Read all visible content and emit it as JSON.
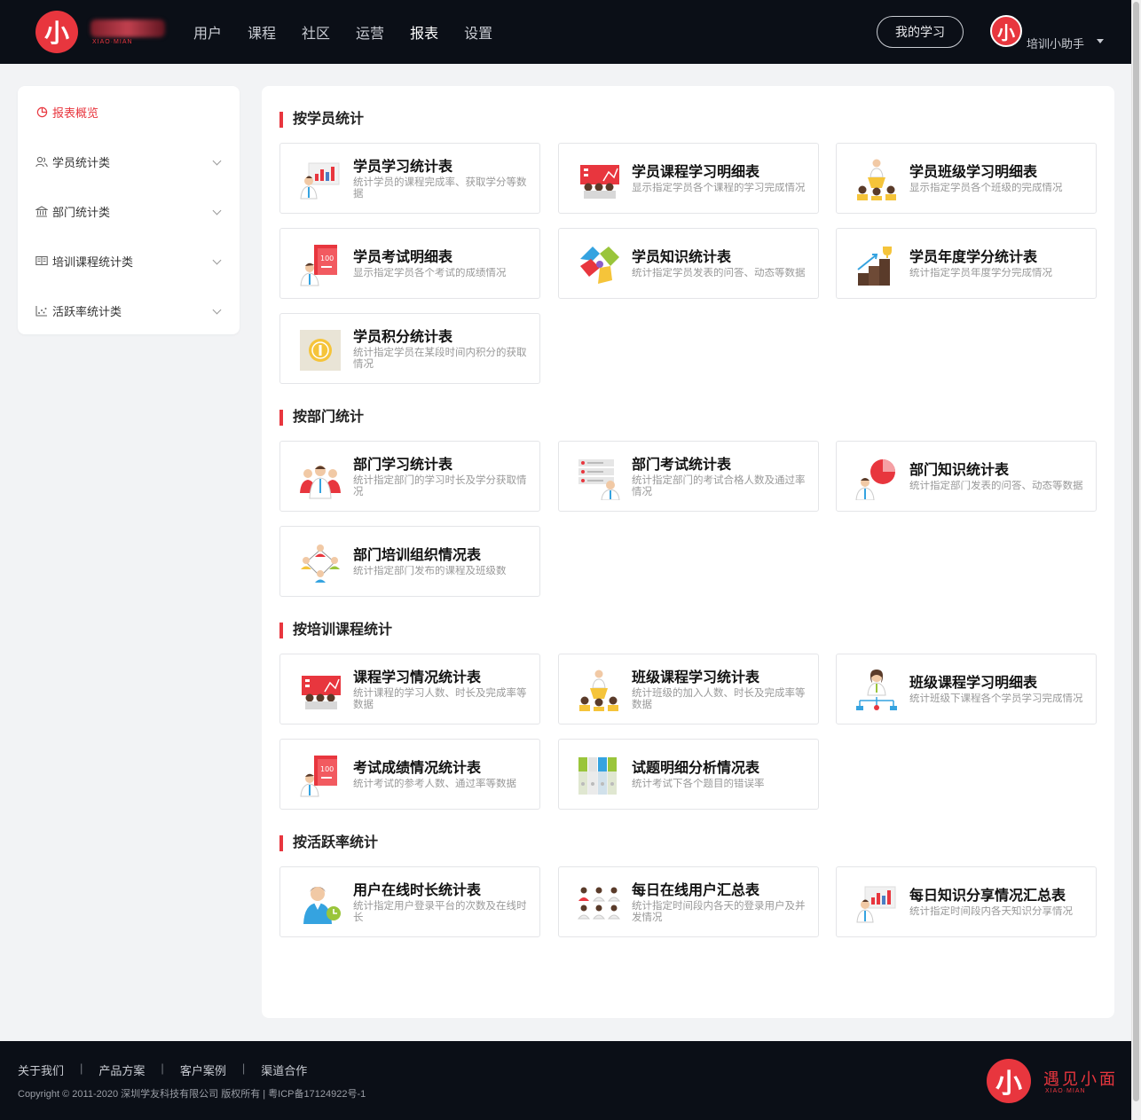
{
  "header": {
    "logo_char": "小",
    "logo_sub": "XIAO·MIAN",
    "nav": [
      "用户",
      "课程",
      "社区",
      "运营",
      "报表",
      "设置"
    ],
    "nav_active_index": 4,
    "my_study": "我的学习",
    "avatar_char": "小",
    "user_name": "培训小助手"
  },
  "sidebar": {
    "items": [
      {
        "label": "报表概览",
        "icon": "pie-chart-icon",
        "active": true
      },
      {
        "label": "学员统计类",
        "icon": "users-icon"
      },
      {
        "label": "部门统计类",
        "icon": "bank-icon"
      },
      {
        "label": "培训课程统计类",
        "icon": "book-icon"
      },
      {
        "label": "活跃率统计类",
        "icon": "scatter-chart-icon"
      }
    ]
  },
  "sections": [
    {
      "title": "按学员统计",
      "cards": [
        {
          "title": "学员学习统计表",
          "desc": "统计学员的课程完成率、获取学分等数据",
          "icon": "presenter-chart-icon"
        },
        {
          "title": "学员课程学习明细表",
          "desc": "显示指定学员各个课程的学习完成情况",
          "icon": "classroom-icon"
        },
        {
          "title": "学员班级学习明细表",
          "desc": "显示指定学员各个班级的完成情况",
          "icon": "podium-speaker-icon"
        },
        {
          "title": "学员考试明细表",
          "desc": "显示指定学员各个考试的成绩情况",
          "icon": "exam-score-icon"
        },
        {
          "title": "学员知识统计表",
          "desc": "统计指定学员发表的问答、动态等数据",
          "icon": "puzzle-icon"
        },
        {
          "title": "学员年度学分统计表",
          "desc": "统计指定学员年度学分完成情况",
          "icon": "trophy-stairs-icon"
        },
        {
          "title": "学员积分统计表",
          "desc": "统计指定学员在某段时间内积分的获取情况",
          "icon": "coin-icon"
        }
      ]
    },
    {
      "title": "按部门统计",
      "cards": [
        {
          "title": "部门学习统计表",
          "desc": "统计指定部门的学习时长及学分获取情况",
          "icon": "team-icon"
        },
        {
          "title": "部门考试统计表",
          "desc": "统计指定部门的考试合格人数及通过率情况",
          "icon": "server-person-icon"
        },
        {
          "title": "部门知识统计表",
          "desc": "统计指定部门发表的问答、动态等数据",
          "icon": "pie-person-icon"
        },
        {
          "title": "部门培训组织情况表",
          "desc": "统计指定部门发布的课程及班级数",
          "icon": "network-people-icon"
        }
      ]
    },
    {
      "title": "按培训课程统计",
      "cards": [
        {
          "title": "课程学习情况统计表",
          "desc": "统计课程的学习人数、时长及完成率等数据",
          "icon": "classroom-icon"
        },
        {
          "title": "班级课程学习统计表",
          "desc": "统计班级的加入人数、时长及完成率等数据",
          "icon": "podium-speaker-icon"
        },
        {
          "title": "班级课程学习明细表",
          "desc": "统计班级下课程各个学员学习完成情况",
          "icon": "org-chart-woman-icon"
        },
        {
          "title": "考试成绩情况统计表",
          "desc": "统计考试的参考人数、通过率等数据",
          "icon": "exam-score-icon"
        },
        {
          "title": "试题明细分析情况表",
          "desc": "统计考试下各个题目的错误率",
          "icon": "binders-icon"
        }
      ]
    },
    {
      "title": "按活跃率统计",
      "cards": [
        {
          "title": "用户在线时长统计表",
          "desc": "统计指定用户登录平台的次数及在线时长",
          "icon": "clock-person-icon"
        },
        {
          "title": "每日在线用户汇总表",
          "desc": "统计指定时间段内各天的登录用户及并发情况",
          "icon": "crowd-icon"
        },
        {
          "title": "每日知识分享情况汇总表",
          "desc": "统计指定时间段内各天知识分享情况",
          "icon": "presenter-chart-icon"
        }
      ]
    }
  ],
  "footer": {
    "links": [
      "关于我们",
      "产品方案",
      "客户案例",
      "渠道合作"
    ],
    "separator": "|",
    "copyright": "Copyright © 2011-2020 深圳学友科技有限公司 版权所有 | 粤ICP备17124922号-1",
    "logo_char": "小",
    "logo_text": "遇见小面",
    "logo_sub": "XIAO·MIAN"
  },
  "colors": {
    "accent": "#e8363e",
    "header_bg": "#0b0f17",
    "page_bg": "#f2f3f5"
  }
}
